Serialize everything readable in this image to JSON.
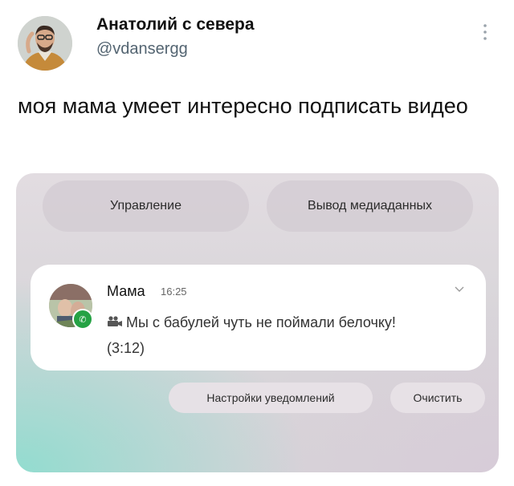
{
  "tweet": {
    "author_name": "Анатолий с севера",
    "author_handle": "@vdansergg",
    "text": "моя мама умеет интересно подписать видео"
  },
  "screenshot": {
    "control_pill_label": "Управление",
    "media_pill_label": "Вывод медиаданных",
    "notification": {
      "sender": "Мама",
      "time": "16:25",
      "icon": "video-camera-icon",
      "body": "Мы с бабулей чуть не поймали белочку! (3:12)",
      "app_badge": "whatsapp-icon"
    },
    "settings_button_label": "Настройки уведомлений",
    "clear_button_label": "Очистить"
  },
  "colors": {
    "handle": "#536471",
    "whatsapp": "#25a244"
  }
}
